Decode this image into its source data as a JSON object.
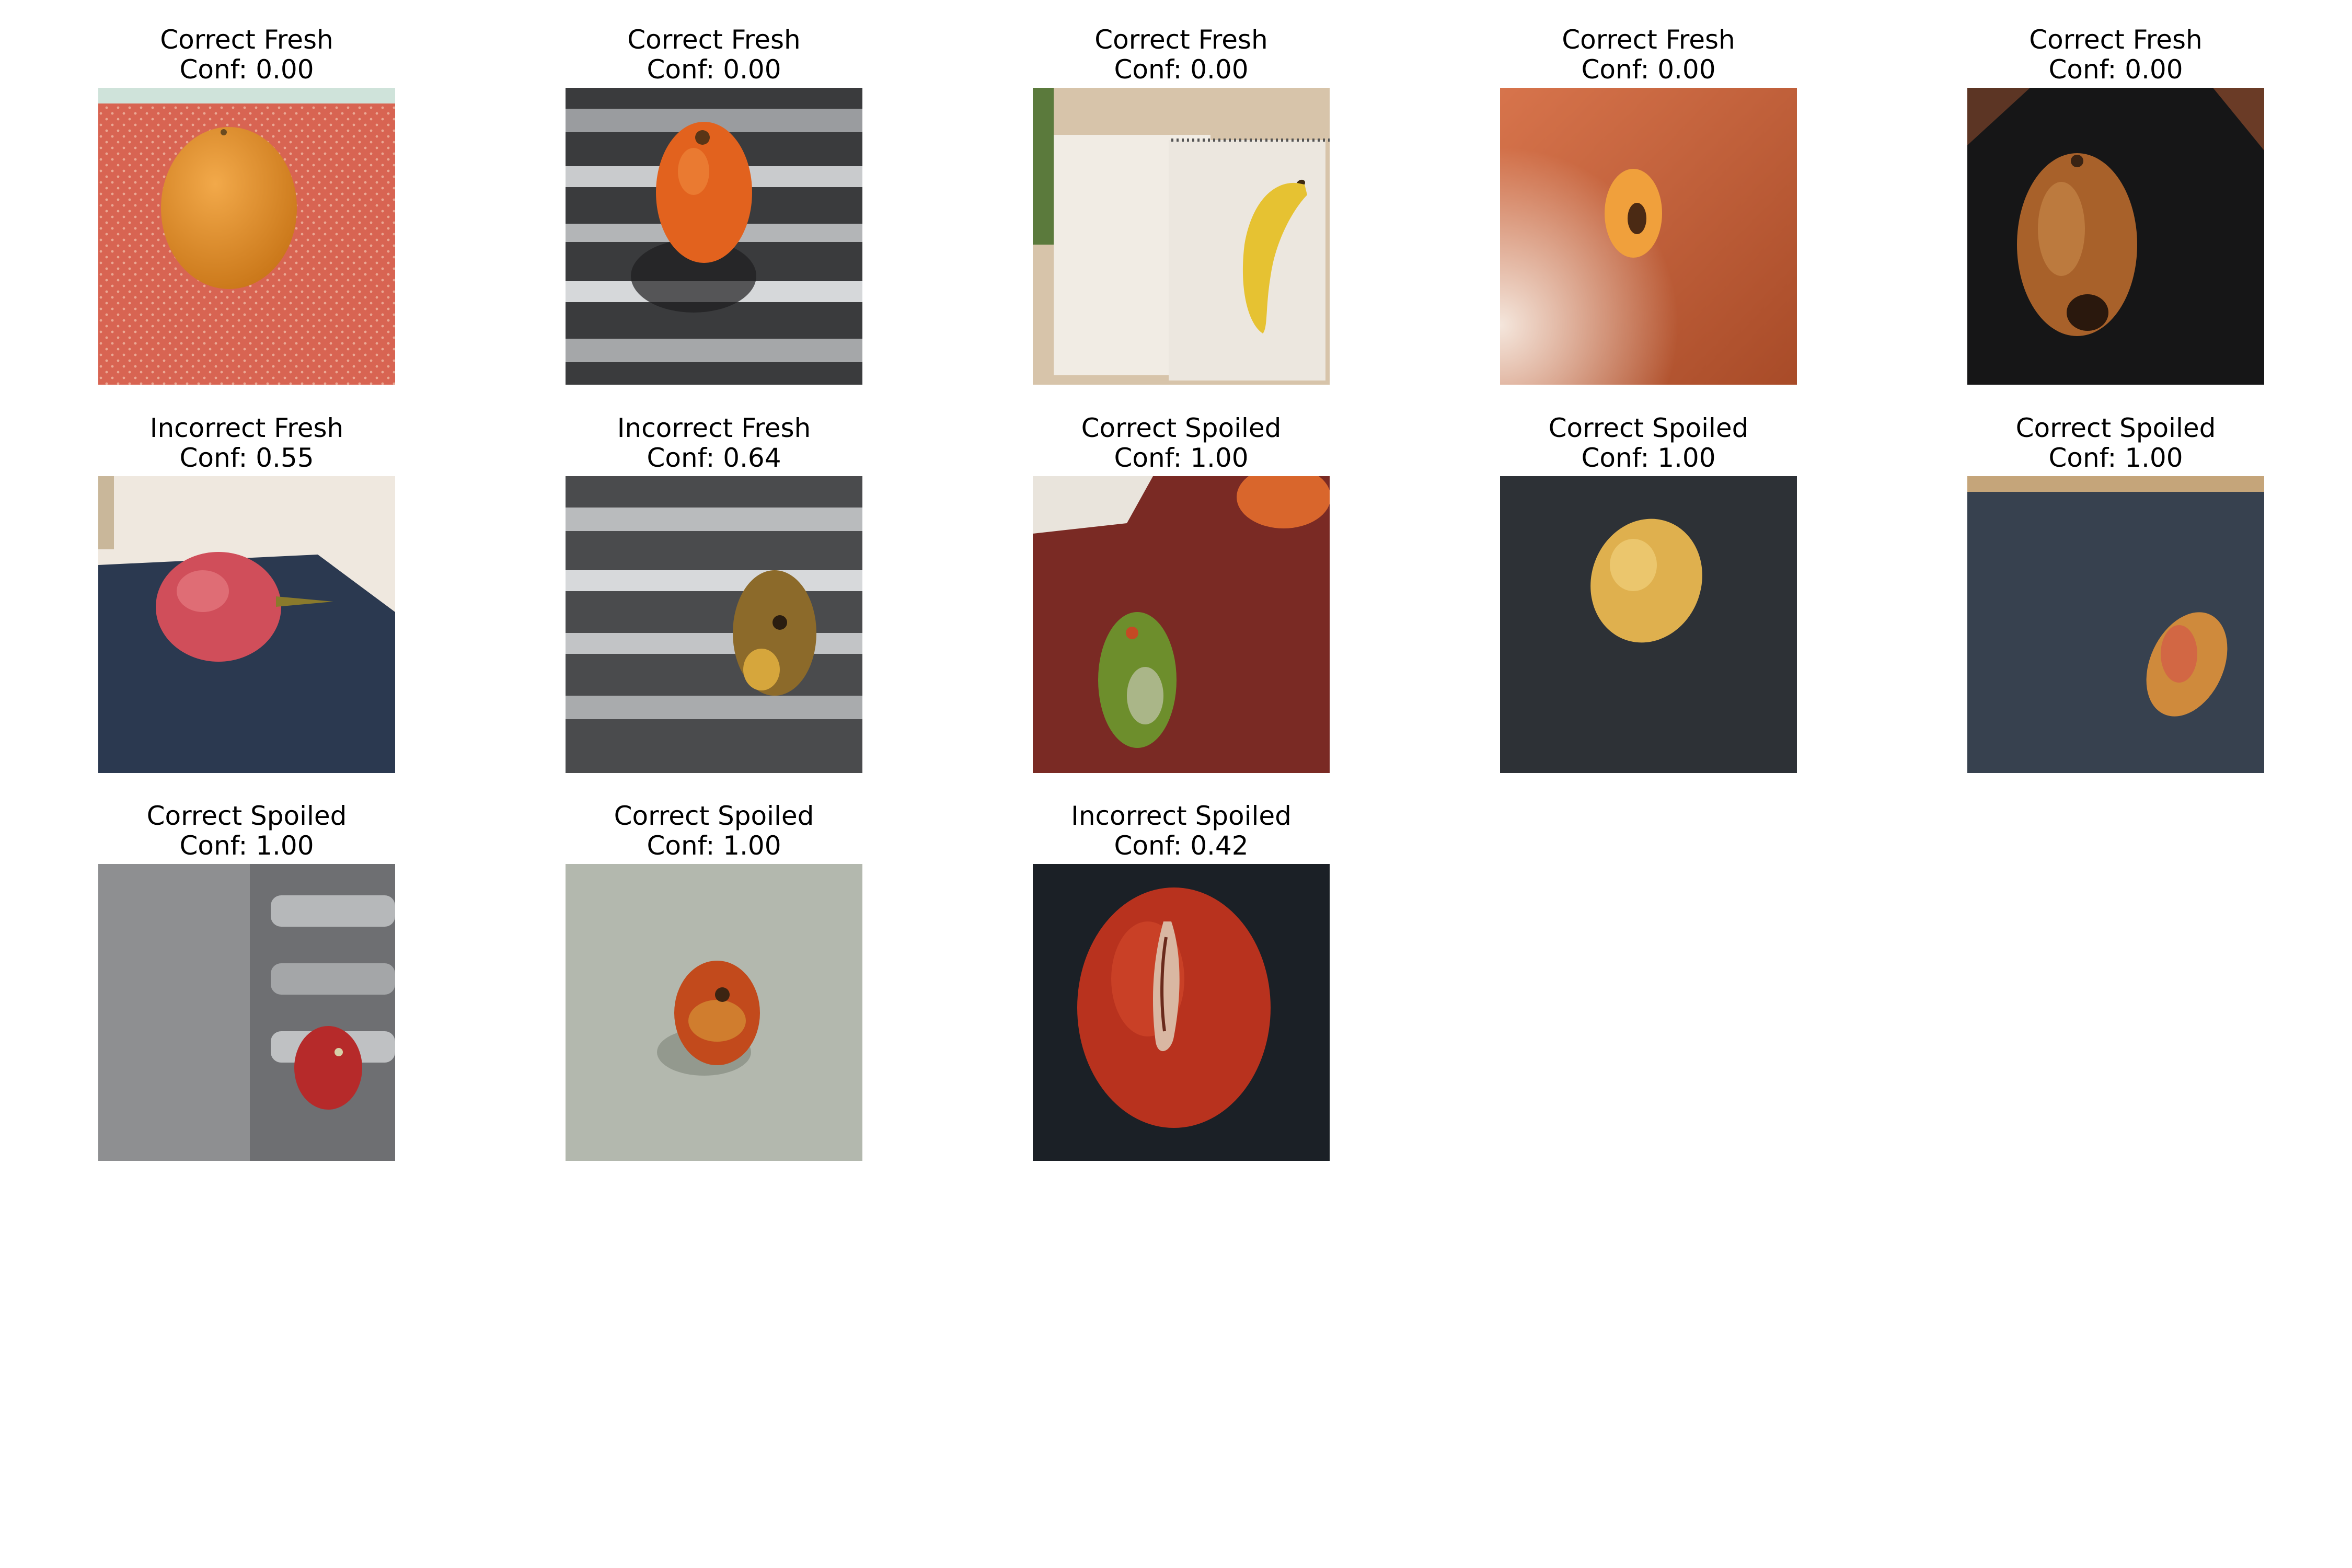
{
  "figure": {
    "panels": [
      {
        "caption": "Correct Fresh",
        "confidence": "Conf: 0.00",
        "photo": "orange-on-red-patterned-cloth"
      },
      {
        "caption": "Correct Fresh",
        "confidence": "Conf: 0.00",
        "photo": "orange-fruit-on-metal-grill"
      },
      {
        "caption": "Correct Fresh",
        "confidence": "Conf: 0.00",
        "photo": "banana-on-notebook"
      },
      {
        "caption": "Correct Fresh",
        "confidence": "Conf: 0.00",
        "photo": "small-orange-fruit-on-wood-table"
      },
      {
        "caption": "Correct Fresh",
        "confidence": "Conf: 0.00",
        "photo": "brown-fruit-on-dark-surface"
      },
      {
        "caption": "Incorrect Fresh",
        "confidence": "Conf: 0.55",
        "photo": "pink-tomato-on-navy-board"
      },
      {
        "caption": "Incorrect Fresh",
        "confidence": "Conf: 0.64",
        "photo": "yellow-brown-fruit-on-metal-grill"
      },
      {
        "caption": "Correct Spoiled",
        "confidence": "Conf: 1.00",
        "photo": "green-spotted-fruit-on-wood-table"
      },
      {
        "caption": "Correct Spoiled",
        "confidence": "Conf: 1.00",
        "photo": "yellow-mango-on-dark-board"
      },
      {
        "caption": "Correct Spoiled",
        "confidence": "Conf: 1.00",
        "photo": "reddish-mango-on-dark-board"
      },
      {
        "caption": "Correct Spoiled",
        "confidence": "Conf: 1.00",
        "photo": "small-tomato-on-metal-sink"
      },
      {
        "caption": "Correct Spoiled",
        "confidence": "Conf: 1.00",
        "photo": "rotten-tomato-on-pale-board"
      },
      {
        "caption": "Incorrect Spoiled",
        "confidence": "Conf: 0.42",
        "photo": "cracked-red-tomato-on-black"
      }
    ]
  }
}
